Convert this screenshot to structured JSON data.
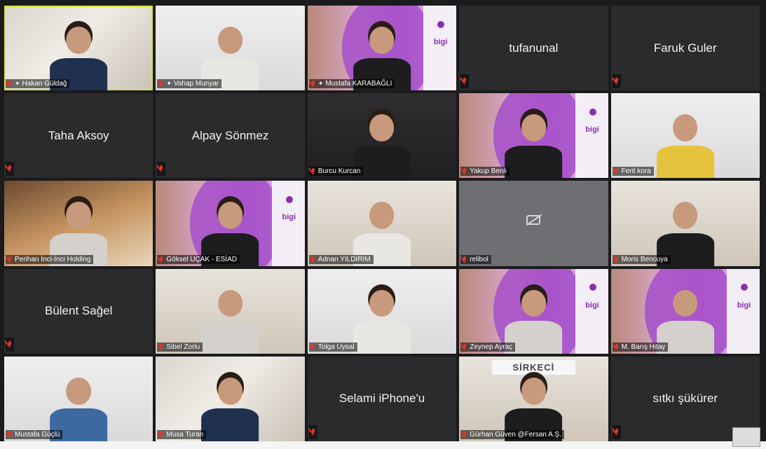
{
  "participants": [
    {
      "name": "Hakan Güldağ",
      "pinned": true,
      "video": true,
      "bg": "office",
      "figure": "body-navy hair-dark",
      "active": true
    },
    {
      "name": "Vahap Munyar",
      "pinned": true,
      "video": true,
      "bg": "room",
      "figure": "body-white"
    },
    {
      "name": "Mustafa KARABAĞLI",
      "pinned": true,
      "video": true,
      "bg": "brand",
      "figure": "body-black hair-dark"
    },
    {
      "name": "tufanunal",
      "video": false
    },
    {
      "name": "Faruk Guler",
      "video": false
    },
    {
      "name": "Taha Aksoy",
      "video": false
    },
    {
      "name": "Alpay Sönmez",
      "video": false
    },
    {
      "name": "Burcu Kurcan",
      "video": true,
      "bg": "dark",
      "figure": "body-black hair-dark"
    },
    {
      "name": "Yakup Benli",
      "video": true,
      "bg": "brand",
      "figure": "body-black hair-dark"
    },
    {
      "name": "Ferit kora",
      "video": true,
      "bg": "room",
      "figure": "body-yellow"
    },
    {
      "name": "Perihan İnci-İnci Holding",
      "video": true,
      "bg": "warm",
      "figure": "body-light hair-dark"
    },
    {
      "name": "Göksel UÇAK - ESİAD",
      "video": true,
      "bg": "brand",
      "figure": "body-black hair-dark"
    },
    {
      "name": "Adnan YILDIRIM",
      "video": true,
      "bg": "home",
      "figure": "body-white"
    },
    {
      "name": "relibol",
      "video": false,
      "camera_off": true
    },
    {
      "name": "Moris Bencuya",
      "video": true,
      "bg": "home",
      "figure": "body-black"
    },
    {
      "name": "Bülent Sağel",
      "video": false
    },
    {
      "name": "Sibel Zorlu",
      "video": true,
      "bg": "home",
      "figure": "body-light"
    },
    {
      "name": "Tolga Uysal",
      "video": true,
      "bg": "room",
      "figure": "body-white hair-dark"
    },
    {
      "name": "Zeynep Ayraç",
      "video": true,
      "bg": "brand",
      "figure": "body-light hair-dark"
    },
    {
      "name": "M. Barış Hitay",
      "video": true,
      "bg": "brand",
      "figure": "body-light"
    },
    {
      "name": "Mustafa Güçlü",
      "video": true,
      "bg": "room",
      "figure": "body-blue"
    },
    {
      "name": "Musa Turan",
      "video": true,
      "bg": "office",
      "figure": "body-navy hair-dark"
    },
    {
      "name": "Selami iPhone'u",
      "video": false
    },
    {
      "name": "Gürhan Güven @Fersan A.Ş.",
      "video": true,
      "bg": "home",
      "figure": "body-black hair-dark",
      "sign": "SİRKECİ"
    },
    {
      "name": "sıtkı şükürer",
      "video": false
    }
  ],
  "brand": {
    "logo_text": "bigi"
  }
}
